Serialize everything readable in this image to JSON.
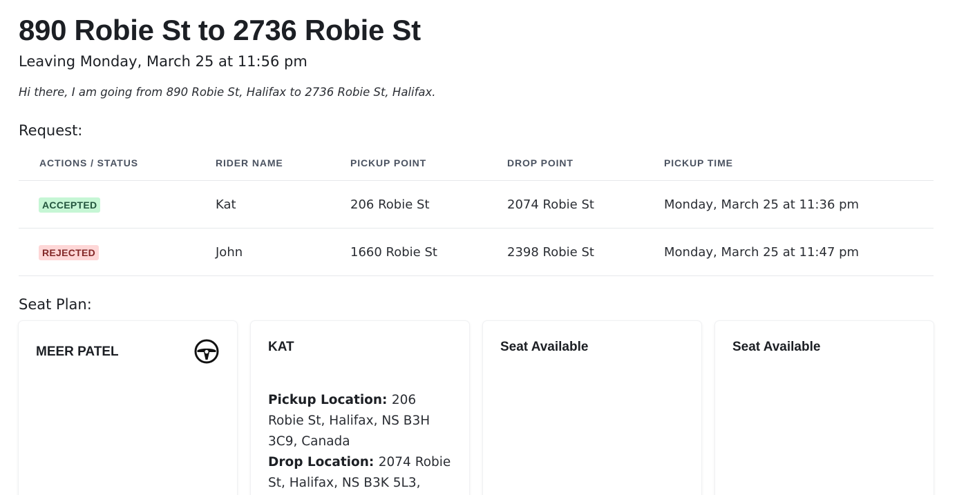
{
  "trip": {
    "title": "890 Robie St to 2736 Robie St",
    "subtitle": "Leaving Monday, March 25 at 11:56 pm",
    "description": "Hi there, I am going from 890 Robie St, Halifax to 2736 Robie St, Halifax."
  },
  "requests": {
    "heading": "Request:",
    "columns": [
      "Actions / Status",
      "Rider Name",
      "Pickup Point",
      "Drop Point",
      "Pickup Time"
    ],
    "rows": [
      {
        "status": "Accepted",
        "rider": "Kat",
        "pickup": "206 Robie St",
        "drop": "2074 Robie St",
        "time": "Monday, March 25 at 11:36 pm"
      },
      {
        "status": "Rejected",
        "rider": "John",
        "pickup": "1660 Robie St",
        "drop": "2398 Robie St",
        "time": "Monday, March 25 at 11:47 pm"
      }
    ]
  },
  "seat_plan": {
    "heading": "Seat Plan:",
    "seats": [
      {
        "name": "MEER PATEL",
        "icon": "steering-wheel-icon"
      },
      {
        "name": "KAT",
        "pickup_label": "Pickup Location:",
        "pickup_value": "206 Robie St, Halifax, NS B3H 3C9, Canada",
        "drop_label": "Drop Location:",
        "drop_value": "2074 Robie St, Halifax, NS B3K 5L3,"
      },
      {
        "name": "Seat Available"
      },
      {
        "name": "Seat Available"
      }
    ]
  },
  "colors": {
    "accepted_bg": "#c6f6d5",
    "accepted_text": "#22543d",
    "rejected_bg": "#fed7d7",
    "rejected_text": "#822727"
  }
}
